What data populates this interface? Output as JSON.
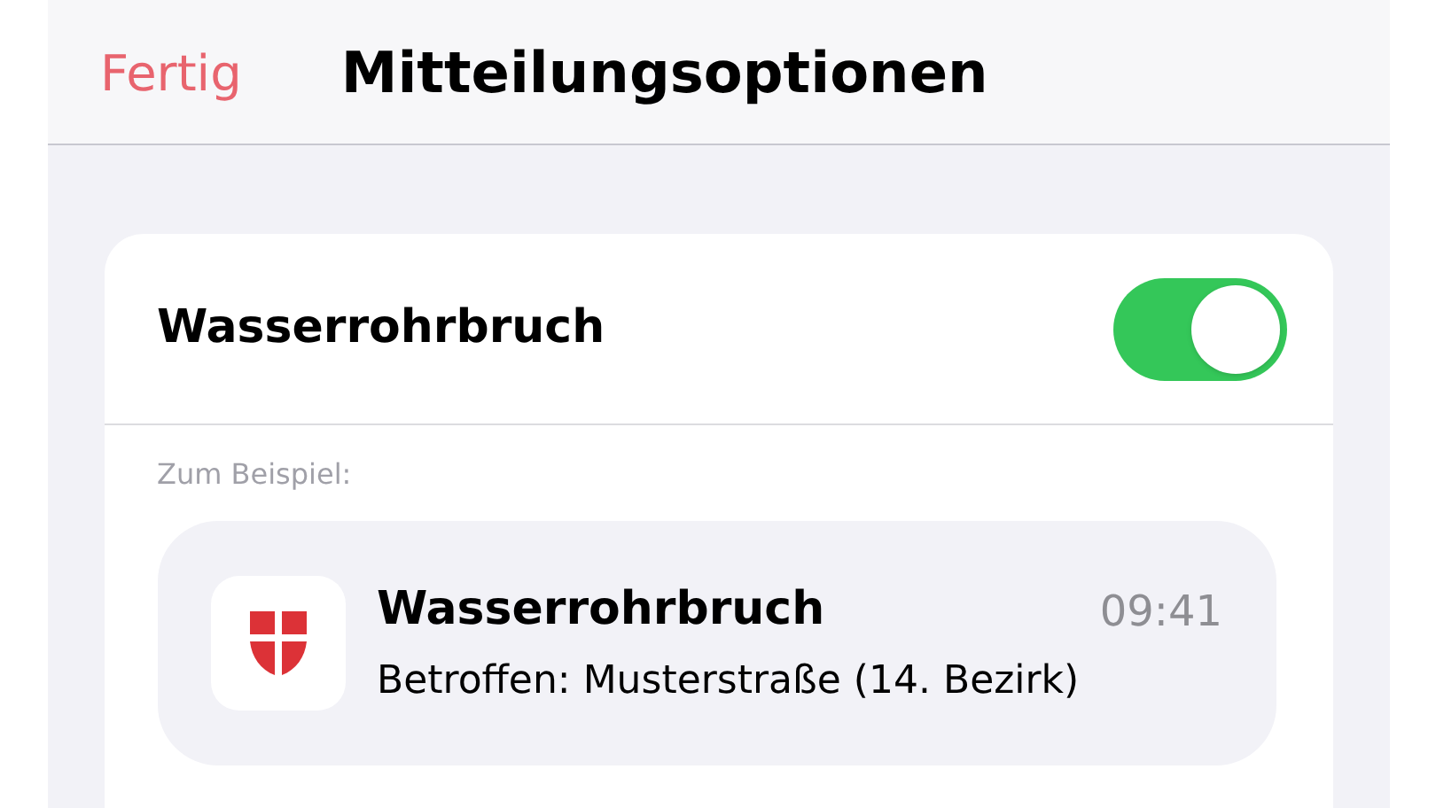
{
  "nav": {
    "done": "Fertig",
    "title": "Mitteilungsoptionen"
  },
  "setting": {
    "label": "Wasserrohrbruch",
    "on": true
  },
  "example_label": "Zum Beispiel:",
  "notification": {
    "title": "Wasserrohrbruch",
    "time": "09:41",
    "body": "Betroffen: Musterstraße (14. Bezirk)"
  }
}
